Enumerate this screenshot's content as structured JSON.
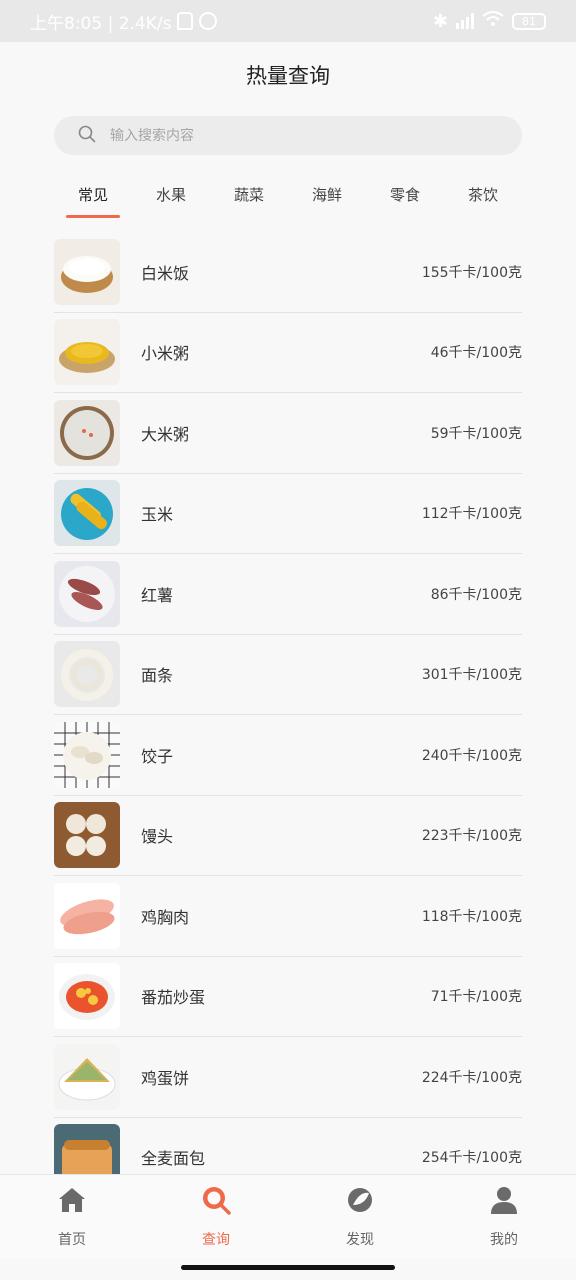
{
  "status_bar": {
    "time_and_speed": "上午8:05 | 2.4K/s",
    "battery": "81"
  },
  "header": {
    "title": "热量查询"
  },
  "search": {
    "placeholder": "输入搜索内容"
  },
  "tabs": [
    {
      "label": "常见",
      "active": true
    },
    {
      "label": "水果"
    },
    {
      "label": "蔬菜"
    },
    {
      "label": "海鲜"
    },
    {
      "label": "零食"
    },
    {
      "label": "茶饮"
    }
  ],
  "foods": [
    {
      "name": "白米饭",
      "kcal": "155千卡/100克"
    },
    {
      "name": "小米粥",
      "kcal": "46千卡/100克"
    },
    {
      "name": "大米粥",
      "kcal": "59千卡/100克"
    },
    {
      "name": "玉米",
      "kcal": "112千卡/100克"
    },
    {
      "name": "红薯",
      "kcal": "86千卡/100克"
    },
    {
      "name": "面条",
      "kcal": "301千卡/100克"
    },
    {
      "name": "饺子",
      "kcal": "240千卡/100克"
    },
    {
      "name": "馒头",
      "kcal": "223千卡/100克"
    },
    {
      "name": "鸡胸肉",
      "kcal": "118千卡/100克"
    },
    {
      "name": "番茄炒蛋",
      "kcal": "71千卡/100克"
    },
    {
      "name": "鸡蛋饼",
      "kcal": "224千卡/100克"
    },
    {
      "name": "全麦面包",
      "kcal": "254千卡/100克"
    }
  ],
  "bottom_nav": [
    {
      "label": "首页",
      "icon": "home-icon"
    },
    {
      "label": "查询",
      "icon": "search-icon",
      "active": true
    },
    {
      "label": "发现",
      "icon": "discover-icon"
    },
    {
      "label": "我的",
      "icon": "profile-icon"
    }
  ],
  "colors": {
    "accent": "#ef6a4b",
    "icon_gray": "#6a6a6a"
  }
}
